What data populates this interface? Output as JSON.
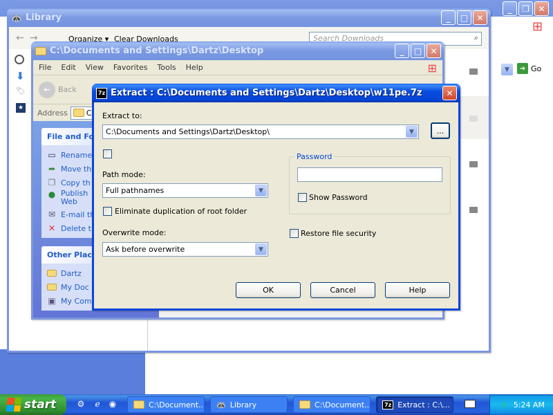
{
  "library_window": {
    "title": "Library",
    "organize_label": "Organize ▾",
    "clear_label": "Clear Downloads",
    "search_placeholder": "Search Downloads",
    "go_label": "Go"
  },
  "desktop_window": {
    "title": "C:\\Documents and Settings\\Dartz\\Desktop",
    "menu": [
      "File",
      "Edit",
      "View",
      "Favorites",
      "Tools",
      "Help"
    ],
    "back_label": "Back",
    "address_label": "Address",
    "address_value": "C:\\",
    "file_tasks": {
      "title": "File and Fo",
      "items": [
        {
          "icon": "rename-icon",
          "label": "Rename"
        },
        {
          "icon": "move-icon",
          "label": "Move th"
        },
        {
          "icon": "copy-icon",
          "label": "Copy th"
        },
        {
          "icon": "publish-icon",
          "label": "Publish",
          "label2": "Web"
        },
        {
          "icon": "email-icon",
          "label": "E-mail th"
        },
        {
          "icon": "delete-icon",
          "label": "Delete t"
        }
      ]
    },
    "other_places": {
      "title": "Other Place",
      "items": [
        {
          "icon": "folder-icon",
          "label": "Dartz"
        },
        {
          "icon": "my-documents-icon",
          "label": "My Doc"
        },
        {
          "icon": "my-computer-icon",
          "label": "My Computer"
        }
      ]
    }
  },
  "extract_dialog": {
    "title": "Extract : C:\\Documents and Settings\\Dartz\\Desktop\\w11pe.7z",
    "extract_to_label": "Extract to:",
    "extract_to_value": "C:\\Documents and Settings\\Dartz\\Desktop\\",
    "browse_label": "...",
    "path_mode_label": "Path mode:",
    "path_mode_value": "Full pathnames",
    "eliminate_label": "Eliminate duplication of root folder",
    "overwrite_mode_label": "Overwrite mode:",
    "overwrite_mode_value": "Ask before overwrite",
    "password_group_label": "Password",
    "password_value": "",
    "show_password_label": "Show Password",
    "restore_security_label": "Restore file security",
    "ok_label": "OK",
    "cancel_label": "Cancel",
    "help_label": "Help"
  },
  "taskbar": {
    "start_label": "start",
    "buttons": [
      {
        "label": "C:\\Document...",
        "icon": "folder-icon"
      },
      {
        "label": "Library",
        "icon": "raccoon-icon"
      },
      {
        "label": "C:\\Document...",
        "icon": "folder-icon"
      },
      {
        "label": "Extract : C:\\...",
        "icon": "7zip-icon"
      }
    ],
    "clock": "5:24 AM"
  }
}
